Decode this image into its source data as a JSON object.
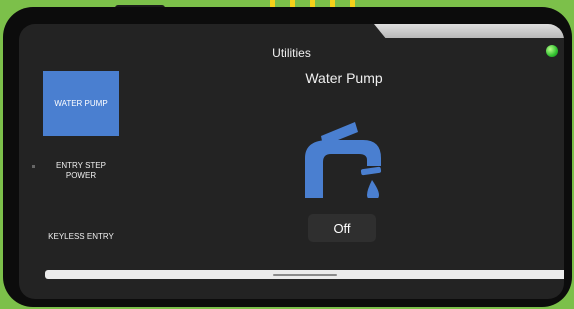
{
  "app": {
    "title": "Utilities"
  },
  "sidebar": {
    "items": [
      {
        "label": "WATER PUMP",
        "selected": true
      },
      {
        "label": "ENTRY STEP POWER",
        "selected": false
      },
      {
        "label": "KEYLESS ENTRY",
        "selected": false
      }
    ]
  },
  "main": {
    "panel_title": "Water Pump",
    "icon": "faucet-icon",
    "toggle_label": "Off"
  },
  "colors": {
    "accent": "#4a7fd0",
    "screen_bg": "#232323",
    "status_indicator": "#2fbf2f"
  }
}
